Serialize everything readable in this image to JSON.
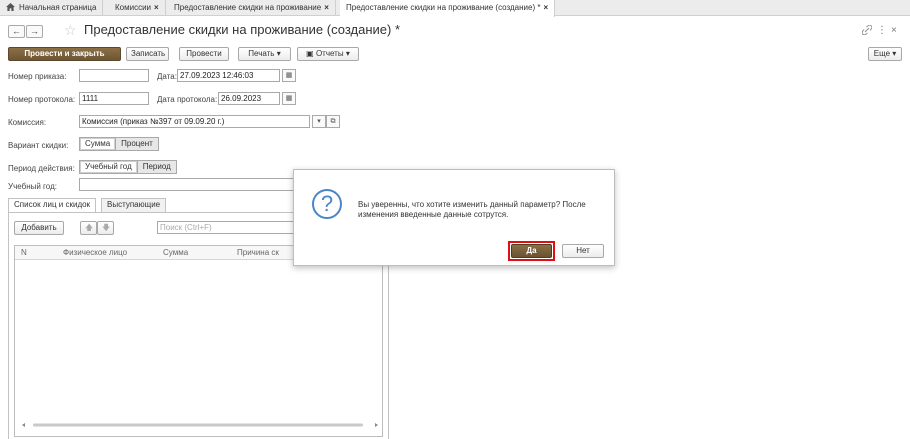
{
  "tabs": [
    {
      "label": "Начальная страница",
      "closable": false
    },
    {
      "label": "Комиссии",
      "closable": true
    },
    {
      "label": "Предоставление скидки на проживание",
      "closable": true
    },
    {
      "label": "Предоставление скидки на проживание (создание) *",
      "closable": true,
      "active": true
    }
  ],
  "header": {
    "title": "Предоставление скидки на проживание (создание) *",
    "back": "←",
    "forward": "→",
    "link_icon": "🔗",
    "more_icon": "⋮",
    "close_icon": "×"
  },
  "toolbar": {
    "post_close": "Провести и закрыть",
    "save": "Записать",
    "post": "Провести",
    "print": "Печать",
    "reports": "Отчеты",
    "more": "Еще"
  },
  "form": {
    "order_num_label": "Номер приказа:",
    "order_num": "",
    "date_label": "Дата:",
    "date": "27.09.2023 12:46:03",
    "protocol_num_label": "Номер протокола:",
    "protocol_num": "1111",
    "protocol_date_label": "Дата протокола:",
    "protocol_date": "26.09.2023",
    "commission_label": "Комиссия:",
    "commission": "Комиссия (приказ №397 от 09.09.20 г.)",
    "discount_variant_label": "Вариант скидки:",
    "discount_options": [
      "Сумма",
      "Процент"
    ],
    "period_label": "Период действия:",
    "period_options": [
      "Учебный год",
      "Период"
    ],
    "study_year_label": "Учебный год:",
    "study_year": ""
  },
  "panel": {
    "tabs": [
      "Список лиц и скидок",
      "Выступающие"
    ],
    "add": "Добавить",
    "search_placeholder": "Поиск (Ctrl+F)",
    "columns": [
      "N",
      "Физическое лицо",
      "Сумма",
      "Причина ск"
    ]
  },
  "modal": {
    "message": "Вы уверенны, что хотите изменить данный параметр? После изменения введенные данные сотрутся.",
    "yes": "Да",
    "no": "Нет",
    "question_glyph": "?"
  },
  "colors": {
    "primary_button": "#7a6140",
    "highlight": "#e01010",
    "question_icon": "#4a86c5"
  }
}
